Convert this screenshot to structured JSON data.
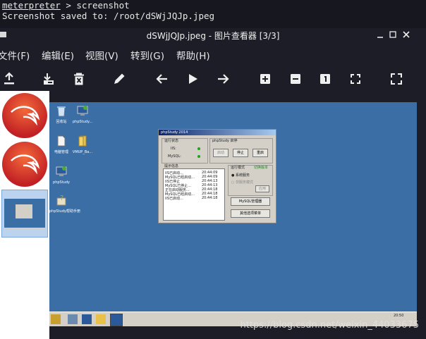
{
  "terminal": {
    "prompt": "meterpreter",
    "command": " > screenshot",
    "output": "Screenshot saved to: /root/dSWjJQJp.jpeg"
  },
  "window": {
    "title": "dSWjJQJp.jpeg - 图片查看器 [3/3]",
    "controls": [
      "minimize",
      "maximize",
      "close"
    ]
  },
  "menu": {
    "items": [
      "文件(F)",
      "编辑(E)",
      "视图(V)",
      "转到(G)",
      "帮助(H)"
    ]
  },
  "toolbar": {
    "tools": [
      "save-icon",
      "set-wallpaper-icon",
      "delete-icon",
      "edit-icon",
      "back-icon",
      "play-icon",
      "forward-icon",
      "zoom-in-icon",
      "zoom-out-icon",
      "actual-size-icon",
      "fit-icon",
      "fullscreen-icon"
    ]
  },
  "thumbnails": {
    "count": 3,
    "selected_index": 3
  },
  "screenshot_content": {
    "desktop_icons": [
      "回收站",
      "phpStudy...",
      "电脑管理",
      "VMUP_Ba...",
      "phpStudy",
      "phpStudy帮助手册"
    ],
    "dialog": {
      "title": "phpStudy 2014",
      "run_status_label": "运行状态",
      "iis_label": "IIS:",
      "mysql_label": "MySQL:",
      "control_label": "phpStudy 启停",
      "buttons": [
        "启动",
        "停止",
        "重启"
      ],
      "log_label": "提示信息",
      "log_lines": [
        [
          "IIS已启动...",
          "20:44:09"
        ],
        [
          "MySQL已经启动...",
          "20:44:09"
        ],
        [
          "IIS已停止",
          "20:44:13"
        ],
        [
          "MySQL已停止...",
          "20:44:13"
        ],
        [
          "正在启动服务...",
          "20:44:18"
        ],
        [
          "MySQL已经启动...",
          "20:44:18"
        ],
        [
          "IIS已启动...",
          "20:44:18"
        ]
      ],
      "mode_label": "运行模式",
      "mode_switch": "切换版本",
      "mode_options": [
        "系统服务",
        "非服务模式"
      ],
      "apply_button": "应用",
      "mysql_manager_button": "MySQL管理器",
      "other_options_button": "其他选项菜单"
    },
    "taskbar_clock": "20:50"
  },
  "watermark": "https://blog.csdn.net/weixin_44033675",
  "colors": {
    "desktop": "#3a6ea5",
    "window_bg": "#1c1d26",
    "thumb_selected": "#bcd3ef"
  }
}
